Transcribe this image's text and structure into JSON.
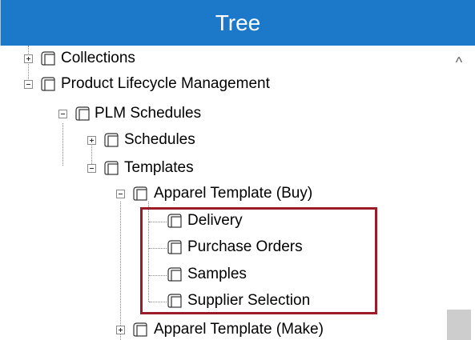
{
  "header": {
    "title": "Tree"
  },
  "scrollbar": {
    "up_arrow": "^"
  },
  "tree": {
    "collections": "Collections",
    "plm": "Product Lifecycle Management",
    "plm_schedules": "PLM Schedules",
    "schedules": "Schedules",
    "templates": "Templates",
    "apparel_buy": "Apparel Template (Buy)",
    "delivery": "Delivery",
    "purchase_orders": "Purchase Orders",
    "samples": "Samples",
    "supplier_selection": "Supplier Selection",
    "apparel_make": "Apparel Template (Make)"
  },
  "colors": {
    "header_bg": "#1c78c8",
    "highlight": "#9c1b28"
  }
}
